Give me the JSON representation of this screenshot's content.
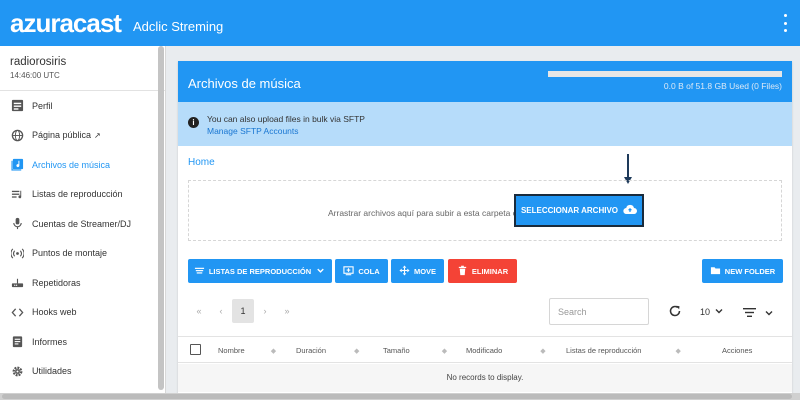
{
  "header": {
    "logo": "azuracast",
    "station_title": "Adclic Streming"
  },
  "sidebar": {
    "station_name": "radiorosiris",
    "station_time": "14:46:00 UTC",
    "items": [
      {
        "label": "Perfil"
      },
      {
        "label": "Página pública"
      },
      {
        "label": "Archivos de música"
      },
      {
        "label": "Listas de reproducción"
      },
      {
        "label": "Cuentas de Streamer/DJ"
      },
      {
        "label": "Puntos de montaje"
      },
      {
        "label": "Repetidoras"
      },
      {
        "label": "Hooks web"
      },
      {
        "label": "Informes"
      },
      {
        "label": "Utilidades"
      }
    ]
  },
  "card": {
    "title": "Archivos de música",
    "quota_text": "0.0 B of 51.8 GB Used (0 Files)",
    "quota_used_fraction": 0
  },
  "info": {
    "line1": "You can also upload files in bulk via SFTP",
    "link": "Manage SFTP Accounts"
  },
  "breadcrumb": {
    "home": "Home"
  },
  "dropzone": {
    "text": "Arrastrar archivos aquí para subir a esta carpeta o",
    "button": "SELECCIONAR ARCHIVO"
  },
  "toolbar": {
    "playlists": "LISTAS DE REPRODUCCIÓN",
    "queue": "COLA",
    "move": "MOVE",
    "delete": "ELIMINAR",
    "new_folder": "NEW FOLDER"
  },
  "pagination": {
    "first": "«",
    "prev": "‹",
    "current": "1",
    "next": "›",
    "last": "»"
  },
  "search": {
    "placeholder": "Search"
  },
  "per_page": "10",
  "table": {
    "columns": [
      "Nombre",
      "Duración",
      "Tamaño",
      "Modificado",
      "Listas de reproducción",
      "Acciones"
    ],
    "empty_text": "No records to display."
  },
  "colors": {
    "primary": "#2196f3",
    "danger": "#f44336",
    "info_bg": "#b6dcfa"
  }
}
